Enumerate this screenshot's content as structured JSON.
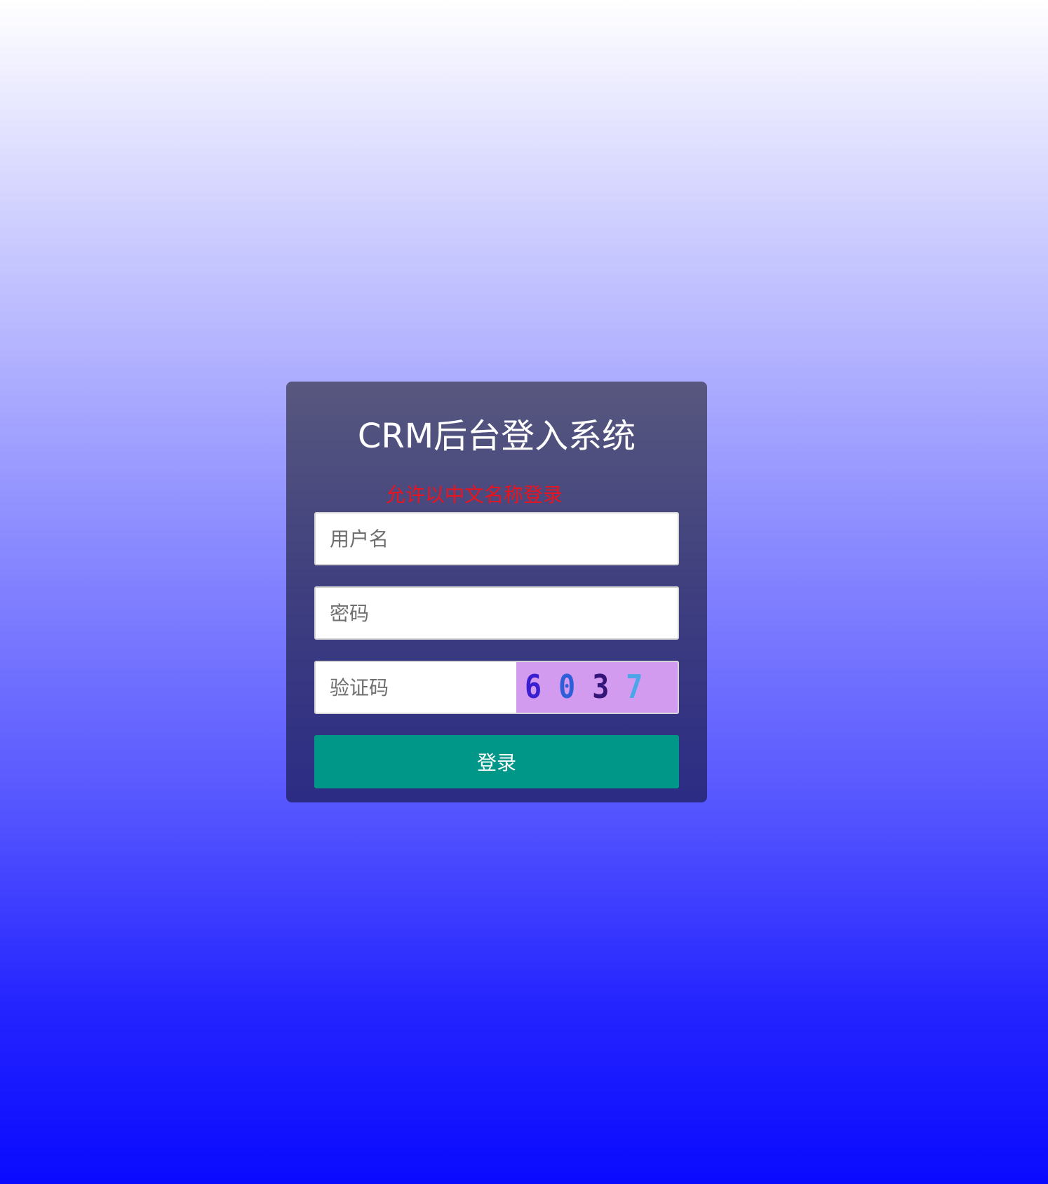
{
  "login": {
    "title": "CRM后台登入系统",
    "hint": "允许以中文名称登录",
    "username_placeholder": "用户名",
    "password_placeholder": "密码",
    "captcha_placeholder": "验证码",
    "captcha_digits": [
      {
        "char": "6",
        "color": "#3a1fd0"
      },
      {
        "char": "0",
        "color": "#2f5fd8"
      },
      {
        "char": "3",
        "color": "#33157a"
      },
      {
        "char": "7",
        "color": "#4aa6e8"
      }
    ],
    "submit_label": "登录"
  },
  "colors": {
    "button_bg": "#009688",
    "hint_color": "#e8141e",
    "captcha_bg": "#d39bf0"
  }
}
